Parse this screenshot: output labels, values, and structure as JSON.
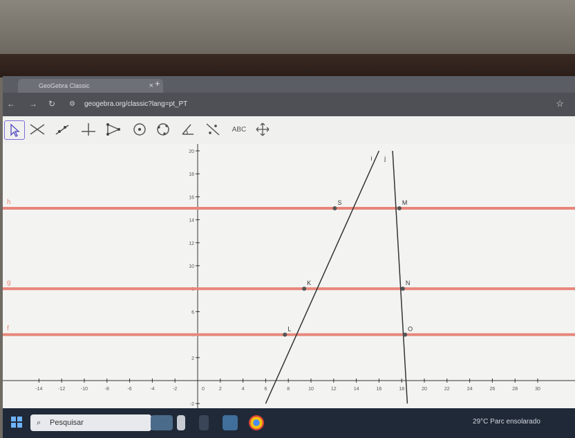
{
  "browser": {
    "tab_title": "GeoGebra Classic",
    "tab_close": "×",
    "new_tab": "+",
    "url": "geogebra.org/classic?lang=pt_PT"
  },
  "toolbar": {
    "tools": [
      "move-tool",
      "line-tool",
      "segment-tool",
      "perpendicular-tool",
      "polygon-tool",
      "circle-tool",
      "conic-tool",
      "angle-tool",
      "reflect-tool",
      "text-tool",
      "move-view-tool"
    ],
    "text_tool_label": "ABC"
  },
  "graph": {
    "x_ticks": [
      -14,
      -12,
      -10,
      -8,
      -6,
      -4,
      -2,
      0,
      2,
      4,
      6,
      8,
      10,
      12,
      14,
      16,
      18,
      20,
      22,
      24,
      26,
      28,
      30
    ],
    "y_ticks": [
      -2,
      2,
      4,
      6,
      8,
      10,
      12,
      14,
      16,
      18,
      20
    ],
    "horizontal_lines": [
      {
        "name": "h",
        "y": 15,
        "color": "#e8867a"
      },
      {
        "name": "g",
        "y": 8,
        "color": "#e8867a"
      },
      {
        "name": "f",
        "y": 4,
        "color": "#e8867a"
      }
    ],
    "slanted_lines": [
      {
        "name": "i",
        "x1": 6,
        "y1": -2,
        "x2": 16,
        "y2": 20
      },
      {
        "name": "j",
        "x1": 18.5,
        "y1": -2,
        "x2": 17.2,
        "y2": 20
      }
    ],
    "points": [
      {
        "name": "S",
        "x": 12.1,
        "y": 15
      },
      {
        "name": "K",
        "x": 9.4,
        "y": 8
      },
      {
        "name": "L",
        "x": 7.7,
        "y": 4
      },
      {
        "name": "M",
        "x": 17.8,
        "y": 15
      },
      {
        "name": "N",
        "x": 18.1,
        "y": 8
      },
      {
        "name": "O",
        "x": 18.3,
        "y": 4
      }
    ]
  },
  "taskbar": {
    "search_label": "Pesquisar",
    "weather": "29°C  Parc ensolarado"
  }
}
